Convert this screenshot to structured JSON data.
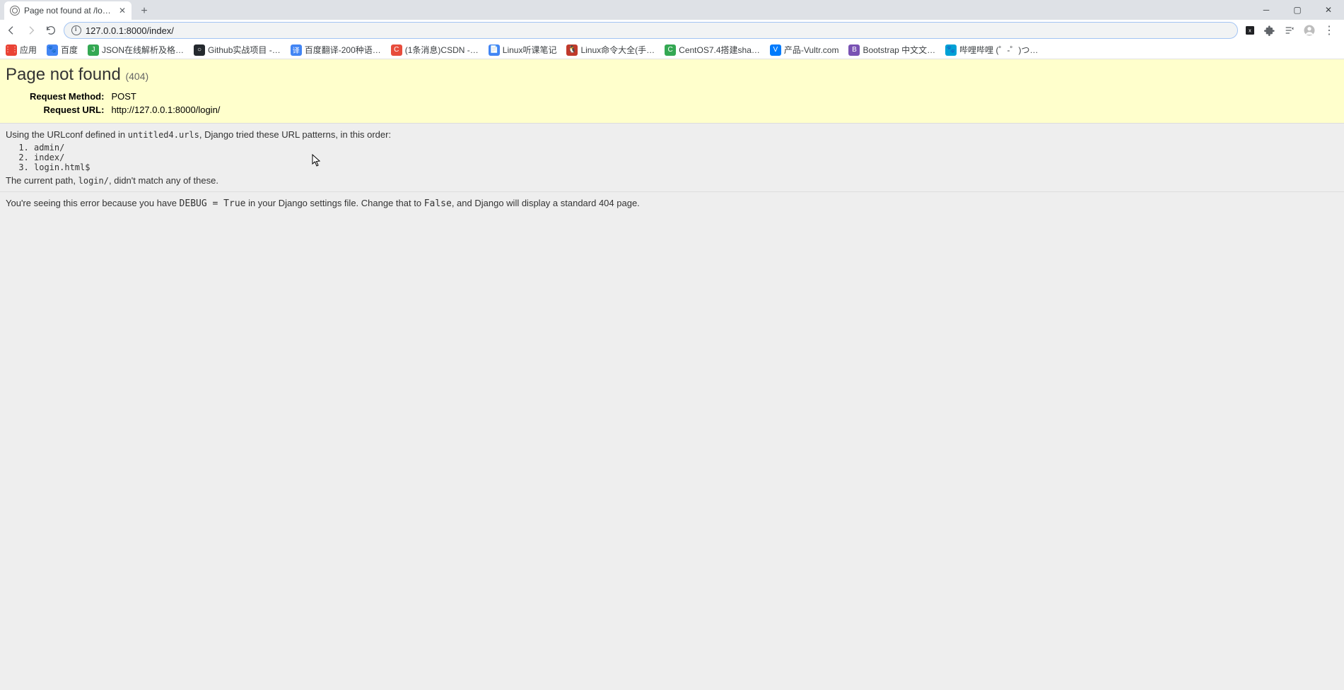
{
  "browser": {
    "tab_title": "Page not found at /login/",
    "url": "127.0.0.1:8000/index/",
    "bookmarks": [
      {
        "label": "应用",
        "color": "#ea4335",
        "mark": "⋮⋮"
      },
      {
        "label": "百度",
        "color": "#4285f4",
        "mark": "🐾"
      },
      {
        "label": "JSON在线解析及格…",
        "color": "#34a853",
        "mark": "J"
      },
      {
        "label": "Github实战项目 -…",
        "color": "#24292e",
        "mark": "○"
      },
      {
        "label": "百度翻译-200种语…",
        "color": "#4285f4",
        "mark": "译"
      },
      {
        "label": "(1条消息)CSDN -…",
        "color": "#e74c3c",
        "mark": "C"
      },
      {
        "label": "Linux听课笔记",
        "color": "#4285f4",
        "mark": "📄"
      },
      {
        "label": "Linux命令大全(手…",
        "color": "#c0392b",
        "mark": "🐧"
      },
      {
        "label": "CentOS7.4搭建sha…",
        "color": "#34a853",
        "mark": "C"
      },
      {
        "label": "产品-Vultr.com",
        "color": "#007bfc",
        "mark": "V"
      },
      {
        "label": "Bootstrap 中文文…",
        "color": "#7952b3",
        "mark": "B"
      },
      {
        "label": "哔哩哔哩 (゜-゜)つ…",
        "color": "#00a1d6",
        "mark": "🐾"
      }
    ]
  },
  "django": {
    "title": "Page not found",
    "status_code": "(404)",
    "meta": {
      "method_label": "Request Method:",
      "method_value": "POST",
      "url_label": "Request URL:",
      "url_value": "http://127.0.0.1:8000/login/"
    },
    "urlconf_prefix": "Using the URLconf defined in ",
    "urlconf_module": "untitled4.urls",
    "urlconf_suffix": ", Django tried these URL patterns, in this order:",
    "patterns": [
      "admin/",
      "index/",
      "login.html$"
    ],
    "nomatch_prefix": "The current path, ",
    "nomatch_path": "login/",
    "nomatch_suffix": ", didn't match any of these.",
    "footer_1": "You're seeing this error because you have ",
    "footer_code1": "DEBUG = True",
    "footer_2": " in your Django settings file. Change that to ",
    "footer_code2": "False",
    "footer_3": ", and Django will display a standard 404 page."
  }
}
